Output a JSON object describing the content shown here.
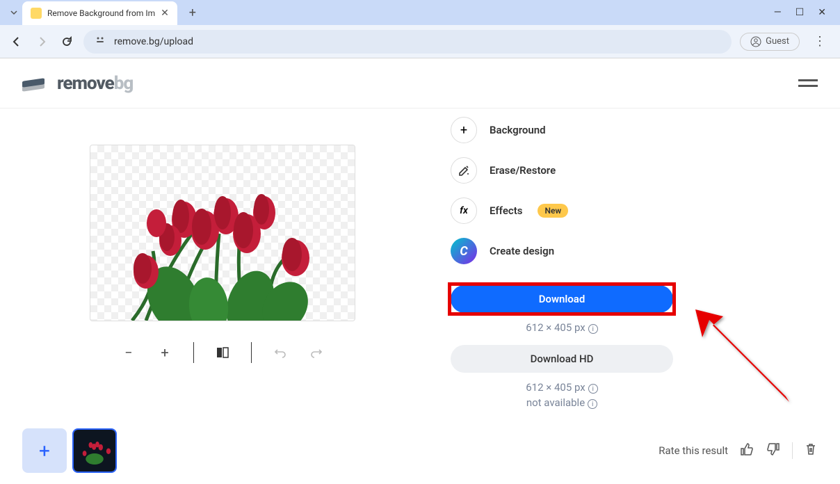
{
  "browser": {
    "tab_title": "Remove Background from Im",
    "url": "remove.bg/upload",
    "guest_label": "Guest"
  },
  "logo": {
    "part1": "remove",
    "part2": "bg"
  },
  "tools": {
    "background": "Background",
    "erase": "Erase/Restore",
    "effects": "Effects",
    "effects_badge": "New",
    "create_design": "Create design"
  },
  "download": {
    "label": "Download",
    "dimensions": "612 × 405 px",
    "hd_label": "Download HD",
    "hd_dimensions": "612 × 405 px",
    "not_available": "not available"
  },
  "rate": {
    "label": "Rate this result"
  }
}
